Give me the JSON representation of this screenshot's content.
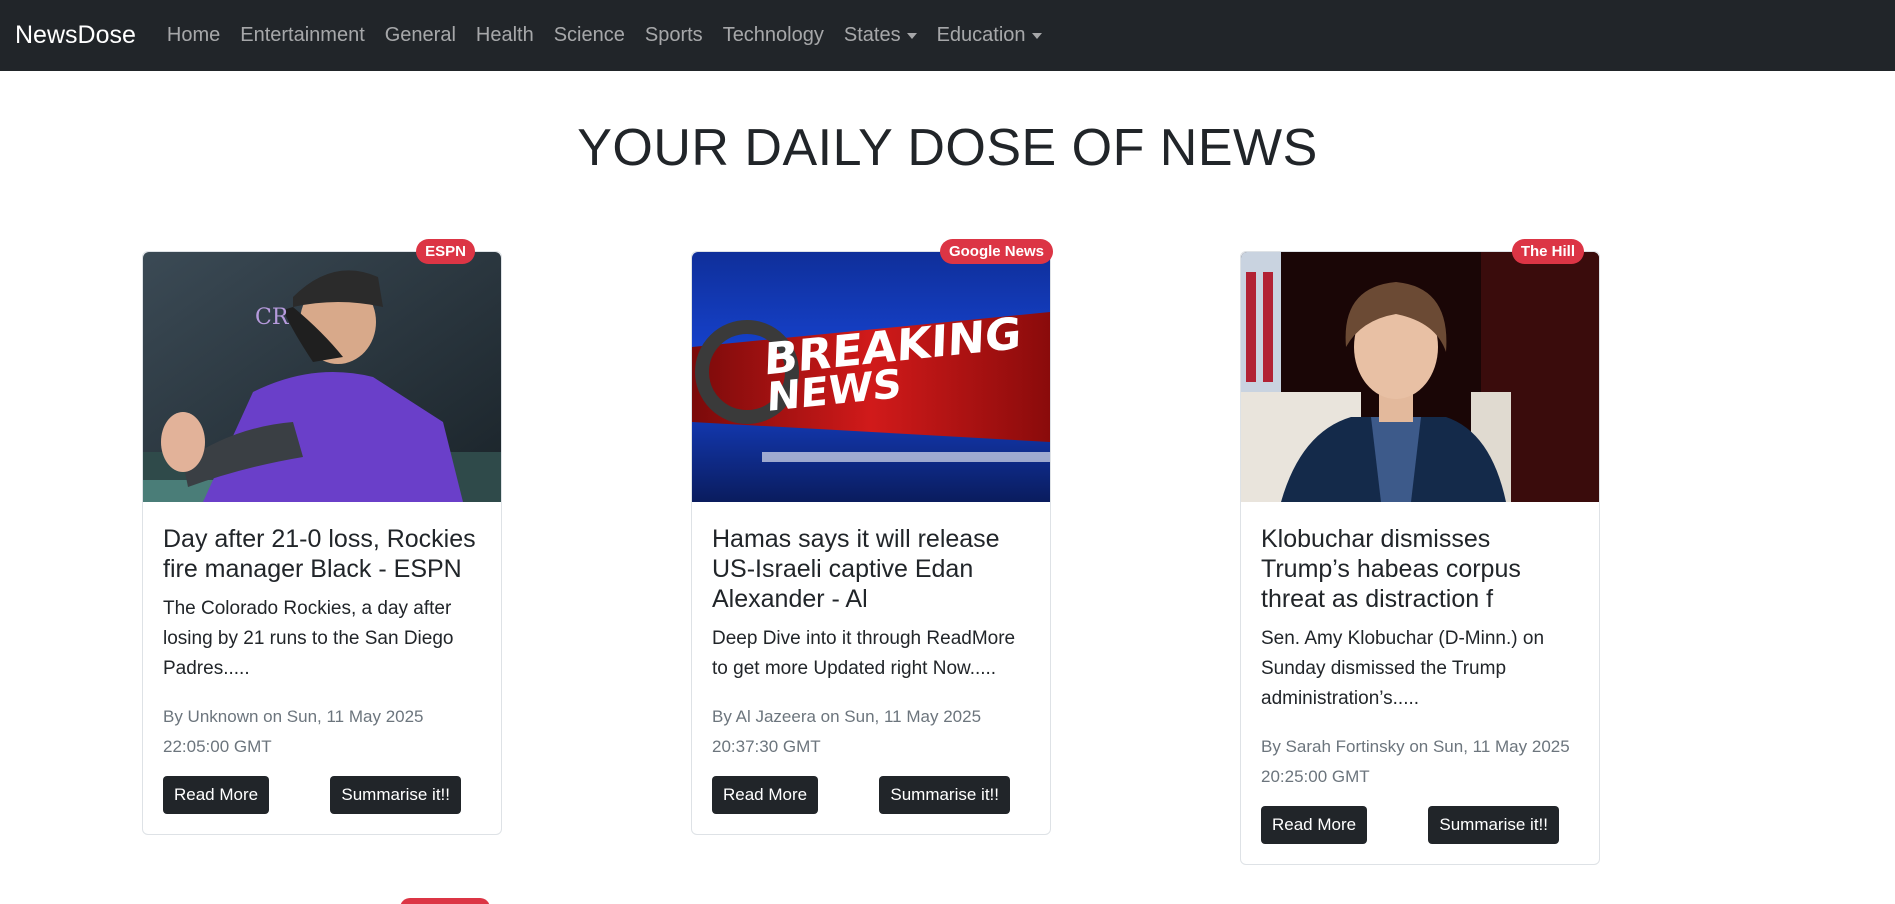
{
  "nav": {
    "brand": "NewsDose",
    "links": [
      "Home",
      "Entertainment",
      "General",
      "Health",
      "Science",
      "Sports",
      "Technology"
    ],
    "dropdowns": [
      "States",
      "Education"
    ]
  },
  "headline": "YOUR DAILY DOSE OF NEWS",
  "cards": [
    {
      "source": "ESPN",
      "title": "Day after 21-0 loss, Rockies fire manager Black - ESPN",
      "description": "The Colorado Rockies, a day after losing by 21 runs to the San Diego Padres.....",
      "meta": "By Unknown on Sun, 11 May 2025 22:05:00 GMT",
      "read_more": "Read More",
      "summarise": "Summarise it!!"
    },
    {
      "source": "Google News",
      "title": "Hamas says it will release US-Israeli captive Edan Alexander - Al",
      "description": "Deep Dive into it through ReadMore to get more Updated right Now.....",
      "meta": "By Al Jazeera on Sun, 11 May 2025 20:37:30 GMT",
      "read_more": "Read More",
      "summarise": "Summarise it!!",
      "image_text": [
        "BREAKING",
        "NEWS"
      ]
    },
    {
      "source": "The Hill",
      "title": "Klobuchar dismisses Trump’s habeas corpus threat as distraction f",
      "description": "Sen. Amy Klobuchar (D-Minn.) on Sunday dismissed the Trump administration’s.....",
      "meta": "By Sarah Fortinsky on Sun, 11 May 2025 20:25:00 GMT",
      "read_more": "Read More",
      "summarise": "Summarise it!!"
    }
  ]
}
